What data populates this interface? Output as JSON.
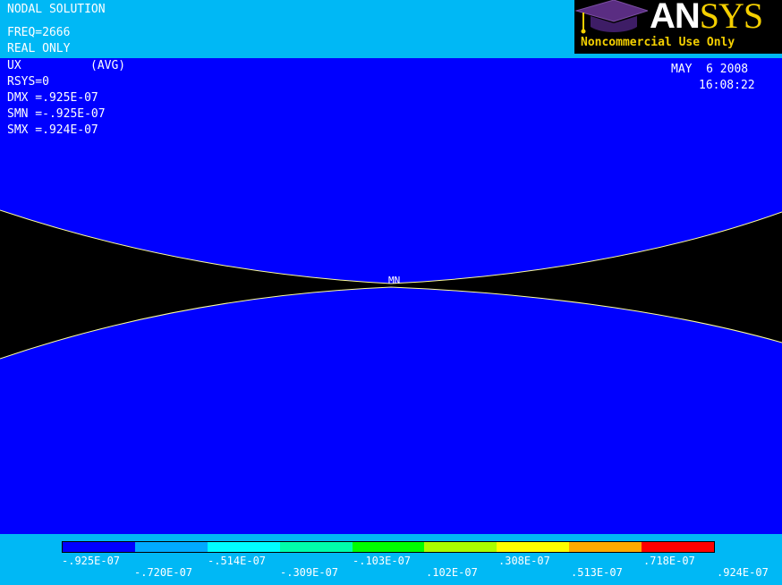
{
  "header": {
    "solution": "NODAL SOLUTION",
    "freq": "FREQ=2666",
    "real": "REAL ONLY",
    "component": "UX",
    "avg": "(AVG)",
    "rsys": "RSYS=0",
    "dmx": "DMX =.925E-07",
    "smn": "SMN =-.925E-07",
    "smx": "SMX =.924E-07"
  },
  "timestamp": {
    "date": "MAY  6 2008",
    "time": "16:08:22"
  },
  "logo": {
    "brand_a": "AN",
    "brand_b": "SYS",
    "subtitle": "Noncommercial Use Only"
  },
  "plot": {
    "min_marker": "MN"
  },
  "legend": {
    "colors": [
      "#0000FF",
      "#00AAFF",
      "#00FFFF",
      "#00FFAA",
      "#00FF00",
      "#AAFF00",
      "#FFFF00",
      "#FFAA00",
      "#FF0000"
    ],
    "top_labels": [
      ".925E-07",
      ".514E-07",
      ".103E-07",
      ".308E-07",
      ".718E-07"
    ],
    "top_labels_prefixed": [
      "-.925E-07",
      "-.514E-07",
      "-.103E-07",
      ".308E-07",
      ".718E-07"
    ],
    "bottom_labels": [
      "-.720E-07",
      "-.309E-07",
      ".102E-07",
      ".513E-07",
      ".924E-07"
    ]
  },
  "colors": {
    "background": "#00B8F5",
    "plot": "#0000FF",
    "gap": "#000000",
    "outline": "#FFFF99",
    "logo_yellow": "#F5D000"
  }
}
